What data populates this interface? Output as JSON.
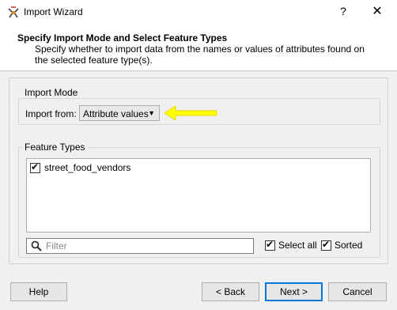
{
  "window": {
    "title": "Import Wizard",
    "help_label": "?",
    "close_label": "✕"
  },
  "header": {
    "title": "Specify Import Mode and Select Feature Types",
    "description": "Specify whether to import data from the names or values of attributes found on the selected feature type(s)."
  },
  "import_mode": {
    "group_title": "Import Mode",
    "label": "Import from:",
    "selected": "Attribute values"
  },
  "feature_types": {
    "group_title": "Feature Types",
    "items": [
      {
        "label": "street_food_vendors",
        "checked": true
      }
    ],
    "filter_placeholder": "Filter",
    "select_all_label": "Select all",
    "sorted_label": "Sorted"
  },
  "buttons": {
    "help": "Help",
    "back": "< Back",
    "next": "Next >",
    "cancel": "Cancel"
  },
  "colors": {
    "annotation_arrow": "#ffff00",
    "primary_border": "#0078d7"
  },
  "icons": [
    "wizard-app-icon",
    "search-icon",
    "dropdown-arrow-icon",
    "checkbox-check-icon"
  ]
}
